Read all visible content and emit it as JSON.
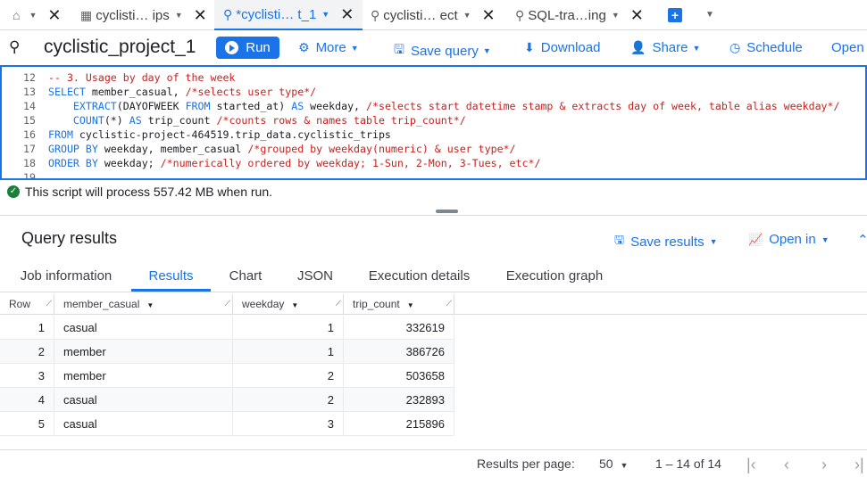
{
  "tabs": [
    {
      "label": "",
      "icon": "home-icon"
    },
    {
      "label": "cyclisti… ips",
      "icon": "table-icon"
    },
    {
      "label": "*cyclisti… t_1",
      "icon": "query-icon"
    },
    {
      "label": "cyclisti… ect",
      "icon": "query-icon"
    },
    {
      "label": "SQL-tra…ing",
      "icon": "query-icon"
    }
  ],
  "toolbar": {
    "title": "cyclistic_project_1",
    "run_label": "Run",
    "more_label": "More",
    "save_query_label": "Save query",
    "download_label": "Download",
    "share_label": "Share",
    "schedule_label": "Schedule",
    "open_label": "Open"
  },
  "editor": {
    "lines": [
      {
        "num": "12",
        "parts": [
          {
            "t": "-- 3. Usage by day of the week",
            "c": "cm"
          }
        ]
      },
      {
        "num": "13",
        "parts": [
          {
            "t": "SELECT",
            "c": "kw"
          },
          {
            "t": " member_casual, ",
            "c": "tx"
          },
          {
            "t": "/*selects user type*/",
            "c": "cm"
          }
        ]
      },
      {
        "num": "14",
        "parts": [
          {
            "t": "    EXTRACT",
            "c": "kw"
          },
          {
            "t": "(DAYOFWEEK ",
            "c": "tx"
          },
          {
            "t": "FROM",
            "c": "kw"
          },
          {
            "t": " started_at) ",
            "c": "tx"
          },
          {
            "t": "AS",
            "c": "kw"
          },
          {
            "t": " weekday, ",
            "c": "tx"
          },
          {
            "t": "/*selects start datetime stamp & extracts day of week, table alias weekday*/",
            "c": "cm"
          }
        ]
      },
      {
        "num": "15",
        "parts": [
          {
            "t": "    COUNT",
            "c": "kw"
          },
          {
            "t": "(*) ",
            "c": "tx"
          },
          {
            "t": "AS",
            "c": "kw"
          },
          {
            "t": " trip_count ",
            "c": "tx"
          },
          {
            "t": "/*counts rows & names table trip_count*/",
            "c": "cm"
          }
        ]
      },
      {
        "num": "16",
        "parts": [
          {
            "t": "FROM",
            "c": "kw"
          },
          {
            "t": " cyclistic-project-464519.trip_data.cyclistic_trips",
            "c": "tx"
          }
        ]
      },
      {
        "num": "17",
        "parts": [
          {
            "t": "GROUP BY",
            "c": "kw"
          },
          {
            "t": " weekday, member_casual ",
            "c": "tx"
          },
          {
            "t": "/*grouped by weekday(numeric) & user type*/",
            "c": "cm"
          }
        ]
      },
      {
        "num": "18",
        "parts": [
          {
            "t": "ORDER BY",
            "c": "kw"
          },
          {
            "t": " weekday; ",
            "c": "tx"
          },
          {
            "t": "/*numerically ordered by weekday; 1-Sun, 2-Mon, 3-Tues, etc*/",
            "c": "cm"
          }
        ]
      },
      {
        "num": "19",
        "parts": []
      }
    ]
  },
  "status": {
    "text": "This script will process 557.42 MB when run."
  },
  "results": {
    "title": "Query results",
    "save_results_label": "Save results",
    "open_in_label": "Open in",
    "tabs": [
      "Job information",
      "Results",
      "Chart",
      "JSON",
      "Execution details",
      "Execution graph"
    ],
    "active_tab": "Results",
    "columns": [
      "Row",
      "member_casual",
      "weekday",
      "trip_count"
    ],
    "rows": [
      [
        "1",
        "casual",
        "1",
        "332619"
      ],
      [
        "2",
        "member",
        "1",
        "386726"
      ],
      [
        "3",
        "member",
        "2",
        "503658"
      ],
      [
        "4",
        "casual",
        "2",
        "232893"
      ],
      [
        "5",
        "casual",
        "3",
        "215896"
      ]
    ]
  },
  "pager": {
    "per_page_label": "Results per page:",
    "per_page_value": "50",
    "range": "1 – 14 of 14"
  },
  "colors": {
    "accent": "#1a73e8",
    "comment": "#c5221f",
    "success": "#188038"
  }
}
